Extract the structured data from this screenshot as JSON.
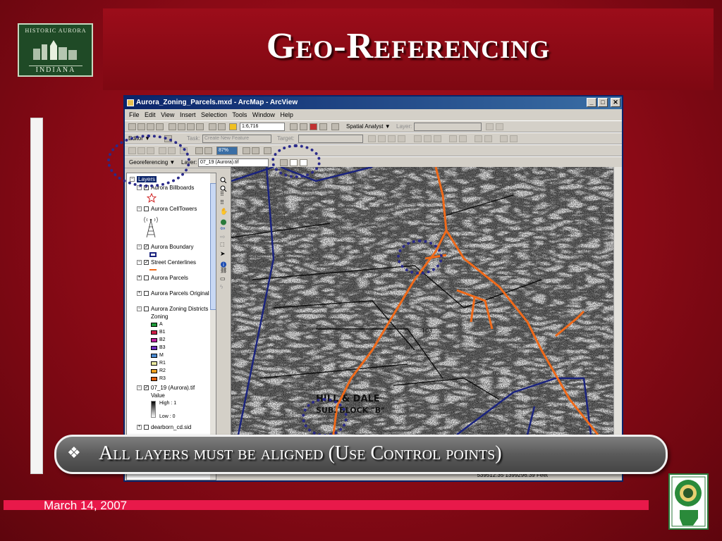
{
  "slide": {
    "title": "Geo-Referencing",
    "bullet_icon": "❖",
    "bullet_text": "All layers must be aligned (Use Control points)",
    "date": "March 14, 2007"
  },
  "logo": {
    "arc_text": "HISTORIC AURORA",
    "state_text": "INDIANA"
  },
  "window": {
    "title": "Aurora_Zoning_Parcels.mxd - ArcMap - ArcView",
    "minimize": "_",
    "maximize": "□",
    "close": "✕"
  },
  "menu": [
    "File",
    "Edit",
    "View",
    "Insert",
    "Selection",
    "Tools",
    "Window",
    "Help"
  ],
  "toolbar": {
    "scale": "1:6,716",
    "spatial_analyst": "Spatial Analyst ▼",
    "layer_label": "Layer:",
    "editor_label": "Editor ▼",
    "task_label": "Task:",
    "task_value": "Create New Feature",
    "target_label": "Target:",
    "zoom_value": "87%",
    "georef_label": "Georeferencing ▼",
    "georef_layer_label": "Layer:",
    "georef_layer_value": "07_19 (Aurora).tif"
  },
  "toc": {
    "root": "Layers",
    "items": [
      "Aurora Billboards",
      "Aurora CellTowers",
      "Aurora Boundary",
      "Street Centerlines",
      "Aurora Parcels",
      "Aurora Parcels Original",
      "Aurora Zoning Districts",
      "07_19 (Aurora).tif",
      "dearborn_cd.sid"
    ],
    "zoning_heading": "Zoning",
    "zones": [
      {
        "label": "A",
        "color": "#1e9a3a"
      },
      {
        "label": "B1",
        "color": "#d0204a"
      },
      {
        "label": "B2",
        "color": "#c020a0"
      },
      {
        "label": "B3",
        "color": "#7030c0"
      },
      {
        "label": "M",
        "color": "#4a8ad0"
      },
      {
        "label": "R1",
        "color": "#e8e8a0"
      },
      {
        "label": "R2",
        "color": "#f0a020"
      },
      {
        "label": "R3",
        "color": "#e06010"
      }
    ],
    "value_heading": "Value",
    "high": "High : 1",
    "low": "Low : 0"
  },
  "map": {
    "labels": {
      "hill_dale": "HILL & DALE",
      "sub_block": "SUB. BLOCK \"B\"",
      "parcel_103": "103"
    },
    "coords": "539512.35   1399296.39 Feet"
  },
  "colors": {
    "boundary": "#1a237e",
    "street": "#f06a1a",
    "slide_bg": "#9c0d1a",
    "footer_bar": "#e8194a"
  }
}
